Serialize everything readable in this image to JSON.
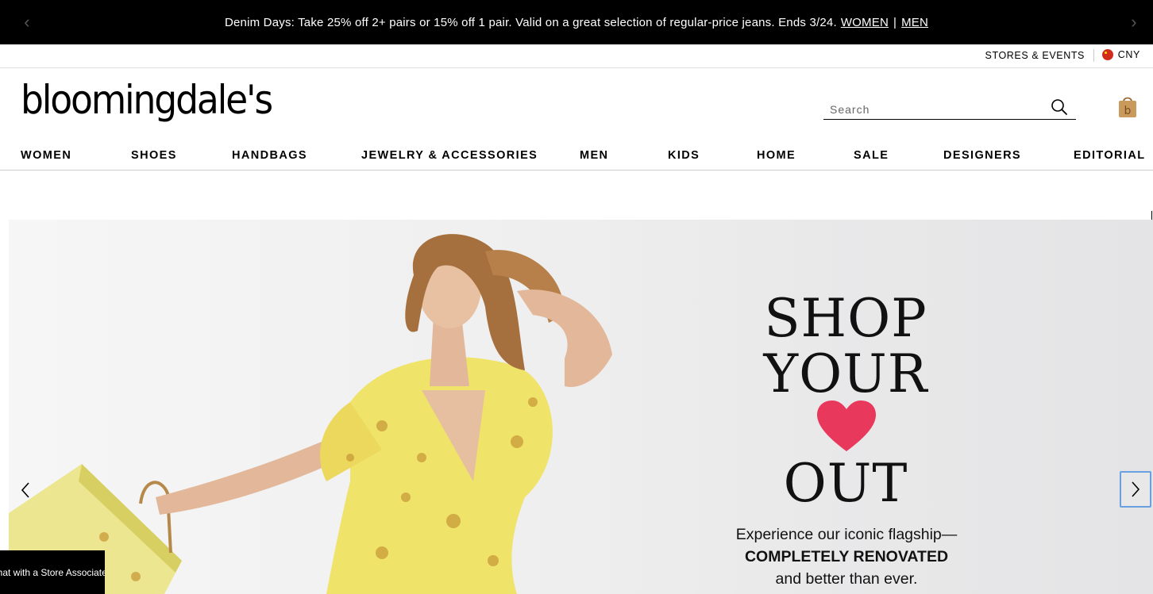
{
  "promo": {
    "text": "Denim Days: Take 25% off 2+ pairs or 15% off 1 pair. Valid on a great selection of regular-price jeans. Ends 3/24.",
    "link_women": "WOMEN",
    "separator": "|",
    "link_men": "MEN",
    "prev_icon": "chevron-left-icon",
    "next_icon": "chevron-right-icon"
  },
  "utility": {
    "stores": "STORES & EVENTS",
    "currency": "CNY",
    "currency_flag": "china-flag-icon"
  },
  "brand": {
    "logo_text": "bloomingdale's"
  },
  "search": {
    "placeholder": "Search",
    "value": ""
  },
  "nav": {
    "items": [
      "WOMEN",
      "SHOES",
      "HANDBAGS",
      "JEWELRY & ACCESSORIES",
      "MEN",
      "KIDS",
      "HOME",
      "SALE",
      "DESIGNERS",
      "EDITORIAL"
    ]
  },
  "hero": {
    "headline_1": "SHOP",
    "headline_2": "YOUR",
    "headline_3": "OUT",
    "heart_color": "#e8385b",
    "sub_1": "Experience our iconic flagship—",
    "sub_2": "COMPLETELY RENOVATED",
    "sub_3": "and better than ever."
  },
  "chat": {
    "label": "Chat with a Store Associate"
  },
  "colors": {
    "promo_bg": "#000000",
    "text": "#000000",
    "dress_yellow": "#efe36a"
  }
}
